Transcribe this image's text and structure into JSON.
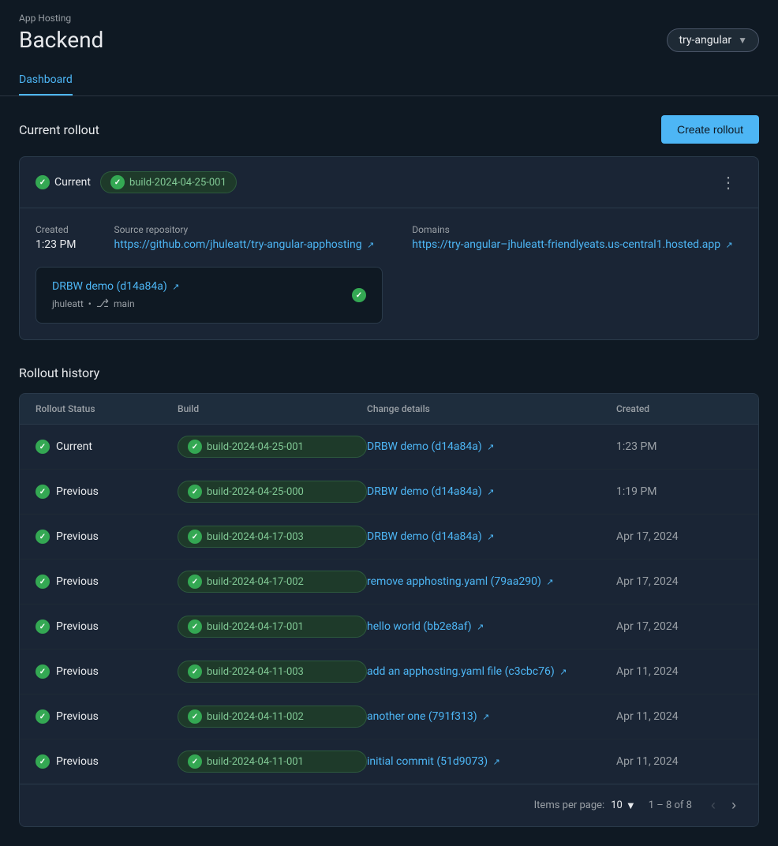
{
  "app": {
    "hosting_label": "App Hosting",
    "title": "Backend",
    "branch": "try-angular"
  },
  "tabs": [
    {
      "label": "Dashboard",
      "active": true
    }
  ],
  "current_rollout": {
    "section_title": "Current rollout",
    "create_btn": "Create rollout",
    "status": "Current",
    "build_id": "build-2024-04-25-001",
    "menu_icon": "⋮",
    "created_label": "Created",
    "created_value": "1:23 PM",
    "source_label": "Source repository",
    "source_url": "https://github.com/jhuleatt/try-angular-apphosting",
    "domains_label": "Domains",
    "domains_url": "https://try-angular–jhuleatt-friendlyeats.us-central1.hosted.app",
    "commit_title": "DRBW demo (d14a84a)",
    "commit_user": "jhuleatt",
    "commit_branch": "main",
    "check_icon": "✓"
  },
  "rollout_history": {
    "title": "Rollout history",
    "columns": {
      "status": "Rollout Status",
      "build": "Build",
      "change": "Change details",
      "created": "Created"
    },
    "rows": [
      {
        "status": "Current",
        "build": "build-2024-04-25-001",
        "change": "DRBW demo (d14a84a)",
        "created": "1:23 PM"
      },
      {
        "status": "Previous",
        "build": "build-2024-04-25-000",
        "change": "DRBW demo (d14a84a)",
        "created": "1:19 PM"
      },
      {
        "status": "Previous",
        "build": "build-2024-04-17-003",
        "change": "DRBW demo (d14a84a)",
        "created": "Apr 17, 2024"
      },
      {
        "status": "Previous",
        "build": "build-2024-04-17-002",
        "change": "remove apphosting.yaml (79aa290)",
        "created": "Apr 17, 2024"
      },
      {
        "status": "Previous",
        "build": "build-2024-04-17-001",
        "change": "hello world (bb2e8af)",
        "created": "Apr 17, 2024"
      },
      {
        "status": "Previous",
        "build": "build-2024-04-11-003",
        "change": "add an apphosting.yaml file (c3cbc76)",
        "created": "Apr 11, 2024"
      },
      {
        "status": "Previous",
        "build": "build-2024-04-11-002",
        "change": "another one (791f313)",
        "created": "Apr 11, 2024"
      },
      {
        "status": "Previous",
        "build": "build-2024-04-11-001",
        "change": "initial commit (51d9073)",
        "created": "Apr 11, 2024"
      }
    ],
    "footer": {
      "items_per_page_label": "Items per page:",
      "items_per_page_value": "10",
      "range": "1 – 8 of 8"
    }
  }
}
